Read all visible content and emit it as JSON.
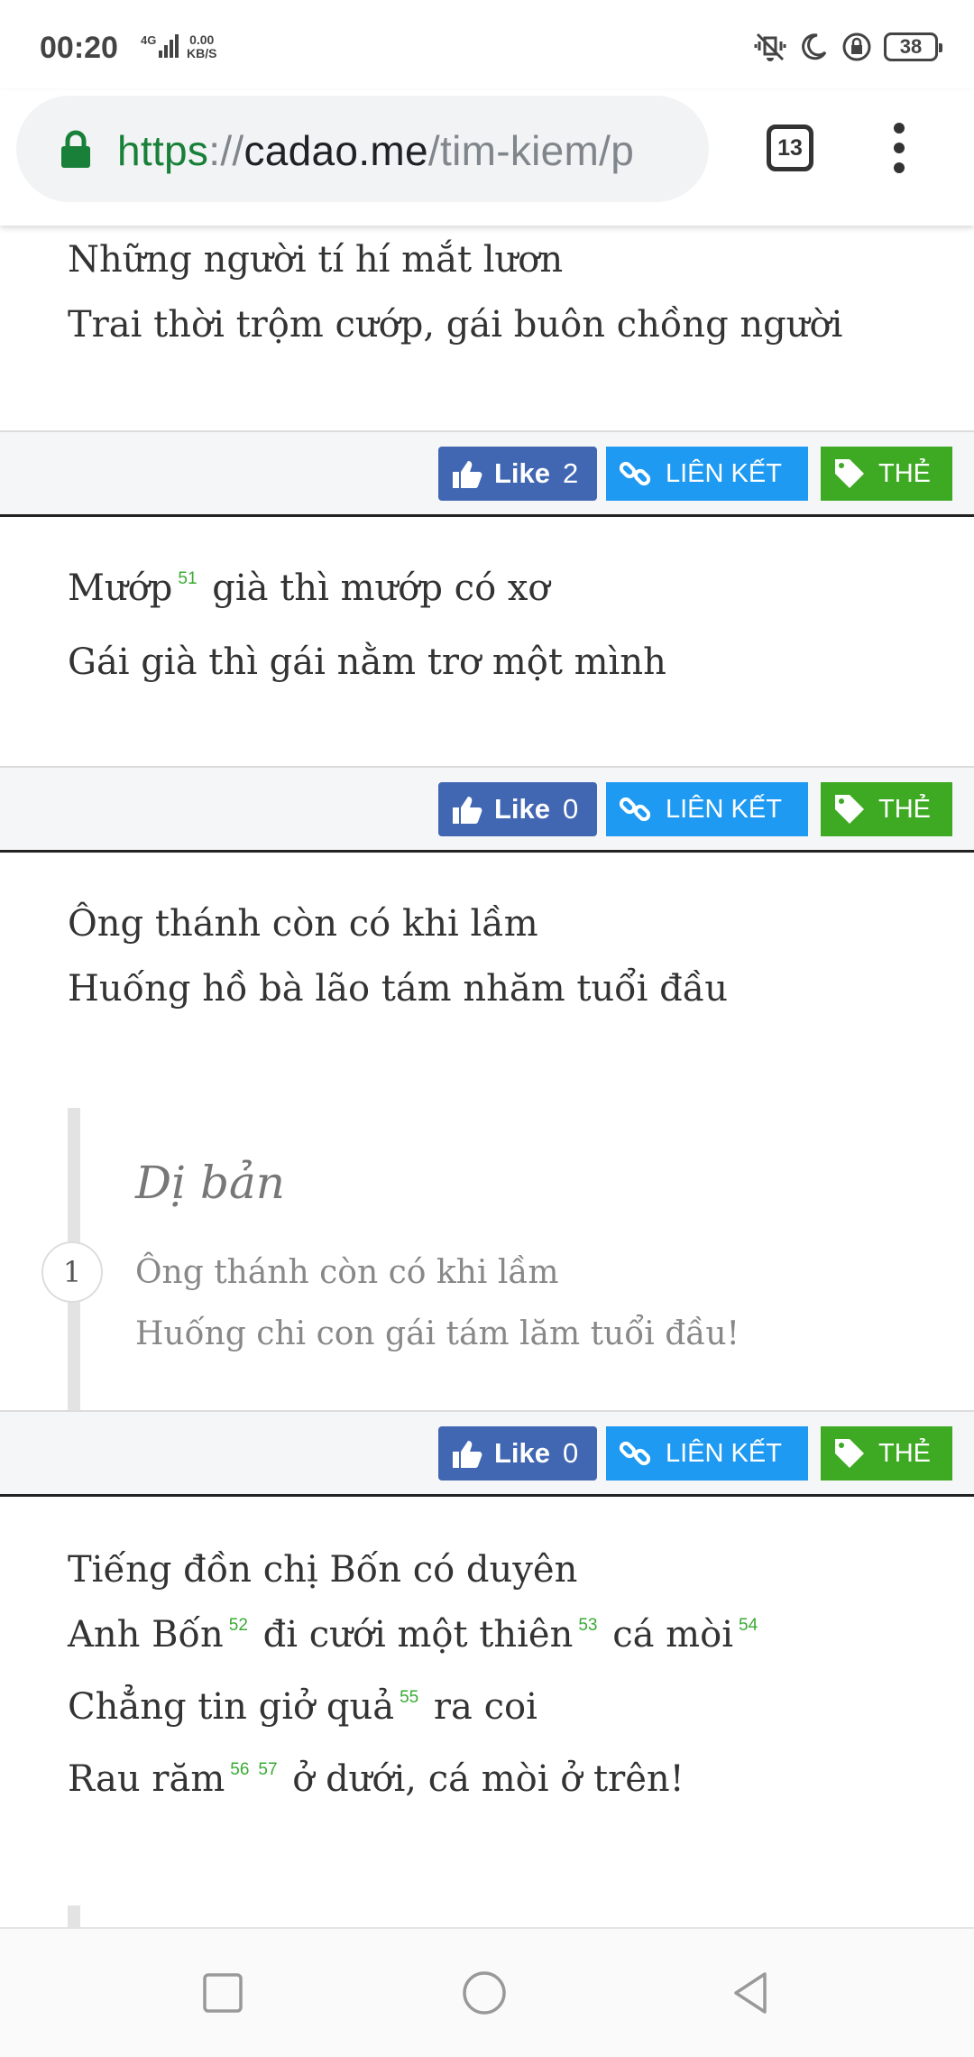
{
  "status_bar": {
    "time": "00:20",
    "network": "4G",
    "speed_value": "0.00",
    "speed_unit": "KB/S",
    "battery": "38"
  },
  "browser": {
    "url_scheme": "https",
    "url_separator": "://",
    "url_host": "cadao.me",
    "url_path": "/tim-kiem/p",
    "tab_count": "13"
  },
  "buttons": {
    "like_label": "Like",
    "link_label": "LIÊN KẾT",
    "tag_label": "THẺ"
  },
  "entries": [
    {
      "lines": [
        "Những người tí hí mắt lươn",
        "Trai thời trộm cướp, gái buôn chồng người"
      ],
      "likes": "2"
    },
    {
      "line1": {
        "a": "Mướp",
        "fn": "51",
        "b": "già thì mướp có xơ"
      },
      "line2": "Gái già thì gái nằm trơ một mình",
      "likes": "0"
    },
    {
      "lines": [
        "Ông thánh còn có khi lầm",
        "Huống hồ bà lão tám nhăm tuổi đầu"
      ],
      "variants_title": "Dị bản",
      "variant_number": "1",
      "variant_lines": [
        "Ông thánh còn có khi lầm",
        "Huống chi con gái tám lăm tuổi đầu!"
      ],
      "likes": "0"
    },
    {
      "line1": "Tiếng đồn chị Bốn có duyên",
      "line2": {
        "a": "Anh Bốn",
        "fn1": "52",
        "b": "đi cưới một thiên",
        "fn2": "53",
        "c": "cá mòi",
        "fn3": "54"
      },
      "line3": {
        "a": "Chẳng tin giở quả",
        "fn": "55",
        "b": "ra coi"
      },
      "line4": {
        "a": "Rau răm",
        "fn1": "56",
        "fn2": "57",
        "b": "ở dưới, cá mòi ở trên!"
      }
    }
  ]
}
